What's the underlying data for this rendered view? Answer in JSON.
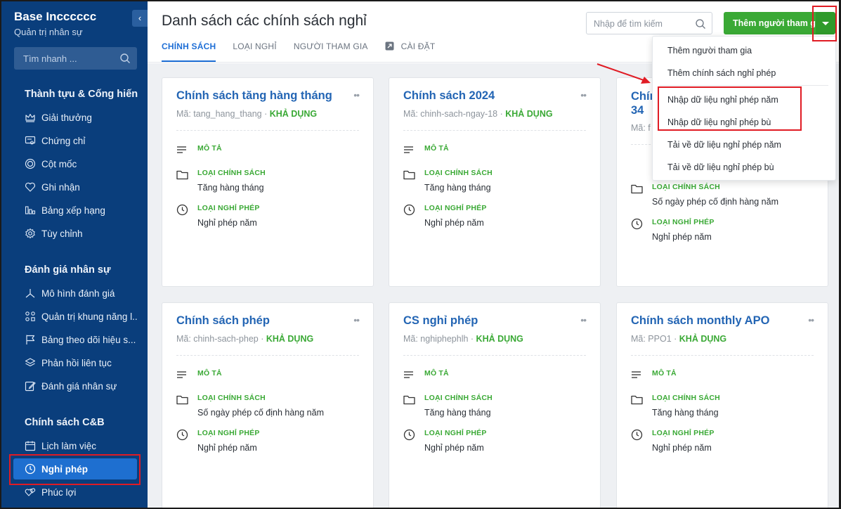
{
  "sidebar": {
    "brand_name": "Base Incccccc",
    "brand_sub": "Quản trị nhân sự",
    "collapse_label": "‹",
    "search_placeholder": "Tìm nhanh ...",
    "groups": [
      {
        "title": "Thành tựu & Cống hiến"
      },
      {
        "title": "Đánh giá nhân sự"
      },
      {
        "title": "Chính sách C&B"
      }
    ],
    "items": [
      {
        "label": "Giải thưởng",
        "icon": "crown-icon"
      },
      {
        "label": "Chứng chỉ",
        "icon": "certificate-icon"
      },
      {
        "label": "Cột mốc",
        "icon": "target-icon"
      },
      {
        "label": "Ghi nhận",
        "icon": "heart-icon"
      },
      {
        "label": "Bảng xếp hạng",
        "icon": "ranking-icon"
      },
      {
        "label": "Tùy chỉnh",
        "icon": "gear-icon"
      },
      {
        "label": "Mô hình đánh giá",
        "icon": "model-icon"
      },
      {
        "label": "Quản trị khung năng l...",
        "icon": "grid-icon"
      },
      {
        "label": "Bảng theo dõi hiệu s...",
        "icon": "flag-icon"
      },
      {
        "label": "Phản hồi liên tục",
        "icon": "layers-icon"
      },
      {
        "label": "Đánh giá nhân sự",
        "icon": "edit-icon"
      },
      {
        "label": "Lịch làm việc",
        "icon": "calendar-icon"
      },
      {
        "label": "Nghỉ phép",
        "icon": "clock-icon"
      },
      {
        "label": "Phúc lợi",
        "icon": "hearts-icon"
      }
    ]
  },
  "header": {
    "title": "Danh sách các chính sách nghỉ",
    "tabs": [
      {
        "label": "CHÍNH SÁCH"
      },
      {
        "label": "LOẠI NGHỈ"
      },
      {
        "label": "NGƯỜI THAM GIA"
      },
      {
        "label": "CÀI ĐẶT"
      }
    ],
    "search_placeholder": "Nhập để tìm kiếm",
    "add_button": "Thêm người tham gia"
  },
  "field_labels": {
    "description": "MÔ TẢ",
    "policy_type": "LOẠI CHÍNH SÁCH",
    "leave_type": "LOẠI NGHỈ PHÉP"
  },
  "cards": [
    {
      "title": "Chính sách tăng hàng tháng",
      "code": "Mã: tang_hang_thang",
      "status": "KHẢ DỤNG",
      "policy_type": "Tăng hàng tháng",
      "leave_type": "Nghỉ phép năm"
    },
    {
      "title": "Chính sách 2024",
      "code": "Mã: chinh-sach-ngay-18",
      "status": "KHẢ DỤNG",
      "policy_type": "Tăng hàng tháng",
      "leave_type": "Nghỉ phép năm"
    },
    {
      "title_line1": "Chín",
      "title_line2": "34",
      "code": "Mã: f",
      "policy_type": "Số ngày phép cố định hàng năm",
      "leave_type": "Nghỉ phép năm"
    },
    {
      "title": "Chính sách phép",
      "code": "Mã: chinh-sach-phep",
      "status": "KHẢ DỤNG",
      "policy_type": "Số ngày phép cố định hàng năm",
      "leave_type": "Nghỉ phép năm"
    },
    {
      "title": "CS nghỉ phép",
      "code": "Mã: nghiphephlh",
      "status": "KHẢ DỤNG",
      "policy_type": "Tăng hàng tháng",
      "leave_type": "Nghỉ phép năm"
    },
    {
      "title": "Chính sách monthly APO",
      "code": "Mã: PPO1",
      "status": "KHẢ DỤNG",
      "policy_type": "Tăng hàng tháng",
      "leave_type": "Nghỉ phép năm"
    }
  ],
  "dropdown": {
    "items": [
      {
        "label": "Thêm người tham gia"
      },
      {
        "label": "Thêm chính sách nghỉ phép"
      },
      {
        "label": "Nhập dữ liệu nghỉ phép năm"
      },
      {
        "label": "Nhập dữ liệu nghỉ phép bù"
      },
      {
        "label": "Tải về dữ liệu nghỉ phép năm"
      },
      {
        "label": "Tải về dữ liệu nghỉ phép bù"
      }
    ]
  },
  "colors": {
    "sidebar_bg": "#0a3e7c",
    "accent_blue": "#1f6fd6",
    "accent_green": "#3aa935",
    "highlight_red": "#e01b24"
  }
}
